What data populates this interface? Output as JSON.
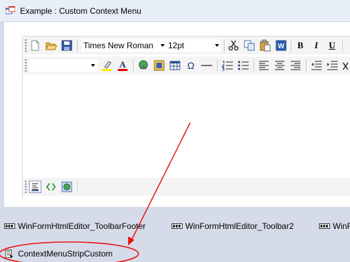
{
  "window": {
    "title": "Example : Custom Context Menu"
  },
  "toolbar_main": {
    "font_name": "Times New Roman",
    "font_size": "12pt",
    "bold_label": "B",
    "italic_label": "I",
    "underline_label": "U"
  },
  "toolbar_format": {
    "style_value": "",
    "omega_label": "Ω"
  },
  "component_tray": {
    "items": [
      {
        "label": "WinFormHtmlEditor_ToolbarFooter"
      },
      {
        "label": "WinFormHtmlEditor_Toolbar2"
      },
      {
        "label": "WinForm"
      },
      {
        "label": "ContextMenuStripCustom"
      }
    ]
  },
  "annotation": {
    "color": "#e8120c"
  }
}
